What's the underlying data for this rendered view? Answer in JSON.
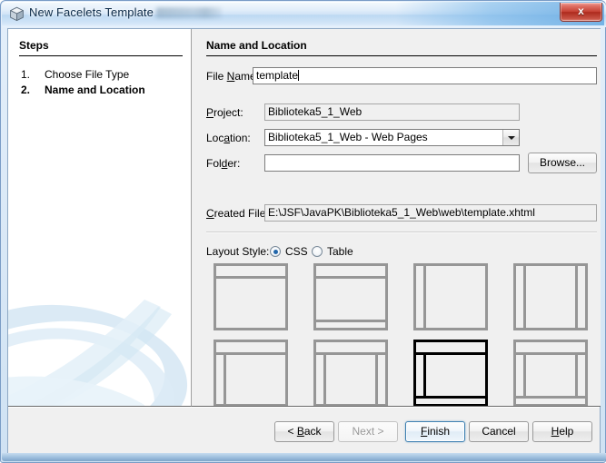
{
  "window": {
    "title": "New Facelets Template",
    "icon": "cube-icon",
    "close_label": "x"
  },
  "steps": {
    "heading": "Steps",
    "items": [
      {
        "number": "1.",
        "label": "Choose File Type",
        "active": false
      },
      {
        "number": "2.",
        "label": "Name and Location",
        "active": true
      }
    ]
  },
  "main": {
    "heading": "Name and Location",
    "fields": {
      "file_name": {
        "label_pre": "File ",
        "label_mn": "N",
        "label_post": "ame:",
        "value": "template"
      },
      "project": {
        "label_mn": "P",
        "label_post": "roject:",
        "value": "Biblioteka5_1_Web"
      },
      "location": {
        "label_pre": "Loc",
        "label_mn": "a",
        "label_post": "tion:",
        "value": "Biblioteka5_1_Web - Web Pages"
      },
      "folder": {
        "label_pre": "Fol",
        "label_mn": "d",
        "label_post": "er:",
        "value": "",
        "placeholder": ""
      },
      "created_file": {
        "label_mn": "C",
        "label_post": "reated File:",
        "value": "E:\\JSF\\JavaPK\\Biblioteka5_1_Web\\web\\template.xhtml"
      }
    },
    "browse_button": "Browse...",
    "layout_style": {
      "label": "Layout Style:",
      "options": [
        {
          "label": "CSS",
          "selected": true
        },
        {
          "label": "Table",
          "selected": false
        }
      ]
    },
    "layouts": [
      {
        "name": "header-content",
        "selected": false,
        "regions": [
          "header",
          "content"
        ]
      },
      {
        "name": "header-content-footer",
        "selected": false,
        "regions": [
          "header",
          "content",
          "footer"
        ]
      },
      {
        "name": "left-content",
        "selected": false,
        "regions": [
          "left",
          "content"
        ]
      },
      {
        "name": "left-content-right",
        "selected": false,
        "regions": [
          "left",
          "content",
          "right"
        ]
      },
      {
        "name": "header-left-content",
        "selected": false,
        "regions": [
          "header",
          "left",
          "content"
        ]
      },
      {
        "name": "header-left-content-right",
        "selected": false,
        "regions": [
          "header",
          "left",
          "content",
          "right"
        ]
      },
      {
        "name": "header-left-content-footer",
        "selected": true,
        "regions": [
          "header",
          "left",
          "content",
          "footer"
        ]
      },
      {
        "name": "header-left-content-right-footer",
        "selected": false,
        "regions": [
          "header",
          "left",
          "content",
          "right",
          "footer"
        ]
      }
    ]
  },
  "buttons": [
    {
      "name": "back",
      "pre": "< ",
      "mn": "B",
      "post": "ack",
      "state": "enabled"
    },
    {
      "name": "next",
      "pre": "",
      "mn": "N",
      "post": "ext >",
      "state": "disabled"
    },
    {
      "name": "finish",
      "pre": "",
      "mn": "F",
      "post": "inish",
      "state": "default"
    },
    {
      "name": "cancel",
      "pre": "",
      "mn": "",
      "post": "Cancel",
      "state": "enabled"
    },
    {
      "name": "help",
      "pre": "",
      "mn": "H",
      "post": "elp",
      "state": "enabled"
    }
  ],
  "colors": {
    "accent": "#3c7fb1",
    "thumb_stroke": "#969696",
    "thumb_selected_stroke": "#000000",
    "close_red": "#c54033",
    "panel_bg": "#f0f0f0"
  }
}
